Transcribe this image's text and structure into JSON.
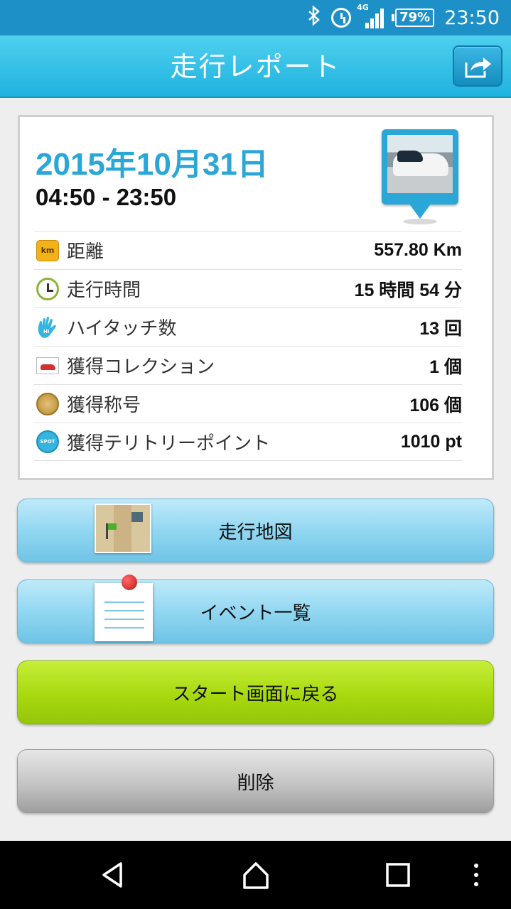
{
  "status_bar": {
    "network": "4G",
    "battery": "79%",
    "time": "23:50",
    "icons": [
      "bluetooth-icon",
      "alarm-icon",
      "signal-icon",
      "battery-icon"
    ]
  },
  "header": {
    "title": "走行レポート",
    "share_icon": "share-icon"
  },
  "report": {
    "date": "2015年10月31日",
    "time_range": "04:50 - 23:50",
    "stats": [
      {
        "icon": "km-icon",
        "label": "距離",
        "value": "557.80 Km"
      },
      {
        "icon": "clock-icon",
        "label": "走行時間",
        "value": "15 時間 54 分"
      },
      {
        "icon": "hand-icon",
        "label": "ハイタッチ数",
        "value": "13 回"
      },
      {
        "icon": "car-icon",
        "label": "獲得コレクション",
        "value": "1 個"
      },
      {
        "icon": "medal-icon",
        "label": "獲得称号",
        "value": "106 個"
      },
      {
        "icon": "spot-icon",
        "label": "獲得テリトリーポイント",
        "value": "1010 pt"
      }
    ]
  },
  "buttons": {
    "map": "走行地図",
    "events": "イベント一覧",
    "back_to_start": "スタート画面に戻る",
    "delete": "削除"
  },
  "nav": {
    "items": [
      "back-icon",
      "home-icon",
      "recents-icon",
      "menu-icon"
    ]
  },
  "colors": {
    "accent": "#2aa7d6",
    "header": "#1fb2df",
    "green_button": "#a8d90e"
  }
}
